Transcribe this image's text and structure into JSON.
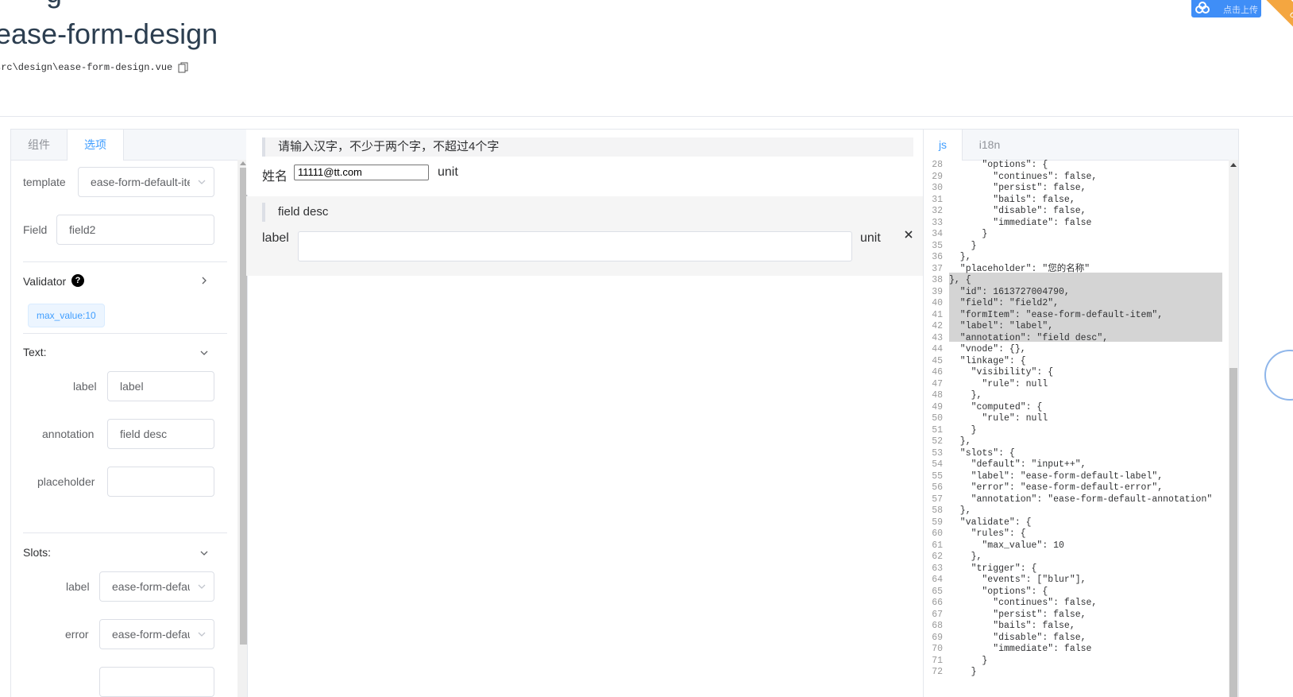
{
  "header": {
    "title": "ease-form-design",
    "file_path": "src\\design\\ease-form-design.vue",
    "badge_text": "点击上传",
    "ribbon_text": "on G"
  },
  "left_panel": {
    "tabs": [
      "组件",
      "选项"
    ],
    "template_label": "template",
    "template_value": "ease-form-default-item",
    "field_label": "Field",
    "field_value": "field2",
    "validator_label": "Validator",
    "validator_tag": "max_value:10",
    "text_section": "Text:",
    "label_label": "label",
    "label_value": "label",
    "annotation_label": "annotation",
    "annotation_value": "field desc",
    "placeholder_label": "placeholder",
    "placeholder_value": "",
    "slots_section": "Slots:",
    "slot_label_label": "label",
    "slot_label_value": "ease-form-default-label",
    "slot_error_label": "error",
    "slot_error_value": "ease-form-default-error"
  },
  "middle_panel": {
    "field1": {
      "annotation": "请输入汉字，不少于两个字，不超过4个字",
      "label": "姓名",
      "value": "11111@tt.com",
      "unit": "unit"
    },
    "field2": {
      "annotation": "field desc",
      "label": "label",
      "value": "",
      "unit": "unit"
    }
  },
  "right_panel": {
    "tabs": [
      "js",
      "i18n"
    ],
    "code_lines": [
      {
        "n": "28",
        "t": "      \"options\": {"
      },
      {
        "n": "29",
        "t": "        \"continues\": false,"
      },
      {
        "n": "30",
        "t": "        \"persist\": false,"
      },
      {
        "n": "31",
        "t": "        \"bails\": false,"
      },
      {
        "n": "32",
        "t": "        \"disable\": false,"
      },
      {
        "n": "33",
        "t": "        \"immediate\": false"
      },
      {
        "n": "34",
        "t": "      }"
      },
      {
        "n": "35",
        "t": "    }"
      },
      {
        "n": "36",
        "t": "  },"
      },
      {
        "n": "37",
        "t": "  \"placeholder\": \"您的名称\""
      },
      {
        "n": "38",
        "t": "}, {"
      },
      {
        "n": "39",
        "t": "  \"id\": 1613727004790,"
      },
      {
        "n": "40",
        "t": "  \"field\": \"field2\","
      },
      {
        "n": "41",
        "t": "  \"formItem\": \"ease-form-default-item\","
      },
      {
        "n": "42",
        "t": "  \"label\": \"label\","
      },
      {
        "n": "43",
        "t": "  \"annotation\": \"field desc\","
      },
      {
        "n": "44",
        "t": "  \"vnode\": {},"
      },
      {
        "n": "45",
        "t": "  \"linkage\": {"
      },
      {
        "n": "46",
        "t": "    \"visibility\": {"
      },
      {
        "n": "47",
        "t": "      \"rule\": null"
      },
      {
        "n": "48",
        "t": "    },"
      },
      {
        "n": "49",
        "t": "    \"computed\": {"
      },
      {
        "n": "50",
        "t": "      \"rule\": null"
      },
      {
        "n": "51",
        "t": "    }"
      },
      {
        "n": "52",
        "t": "  },"
      },
      {
        "n": "53",
        "t": "  \"slots\": {"
      },
      {
        "n": "54",
        "t": "    \"default\": \"input++\","
      },
      {
        "n": "55",
        "t": "    \"label\": \"ease-form-default-label\","
      },
      {
        "n": "56",
        "t": "    \"error\": \"ease-form-default-error\","
      },
      {
        "n": "57",
        "t": "    \"annotation\": \"ease-form-default-annotation\""
      },
      {
        "n": "58",
        "t": "  },"
      },
      {
        "n": "59",
        "t": "  \"validate\": {"
      },
      {
        "n": "60",
        "t": "    \"rules\": {"
      },
      {
        "n": "61",
        "t": "      \"max_value\": 10"
      },
      {
        "n": "62",
        "t": "    },"
      },
      {
        "n": "63",
        "t": "    \"trigger\": {"
      },
      {
        "n": "64",
        "t": "      \"events\": [\"blur\"],"
      },
      {
        "n": "65",
        "t": "      \"options\": {"
      },
      {
        "n": "66",
        "t": "        \"continues\": false,"
      },
      {
        "n": "67",
        "t": "        \"persist\": false,"
      },
      {
        "n": "68",
        "t": "        \"bails\": false,"
      },
      {
        "n": "69",
        "t": "        \"disable\": false,"
      },
      {
        "n": "70",
        "t": "        \"immediate\": false"
      },
      {
        "n": "71",
        "t": "      }"
      },
      {
        "n": "72",
        "t": "    }"
      }
    ]
  },
  "icons": {
    "copy": "copy-icon",
    "help": "question-circle-icon",
    "chevron_right": "chevron-right-icon",
    "chevron_down": "chevron-down-icon",
    "close": "close-icon"
  },
  "colors": {
    "accent": "#409eff",
    "border": "#dcdfe6",
    "highlight": "#d4d4d4"
  }
}
